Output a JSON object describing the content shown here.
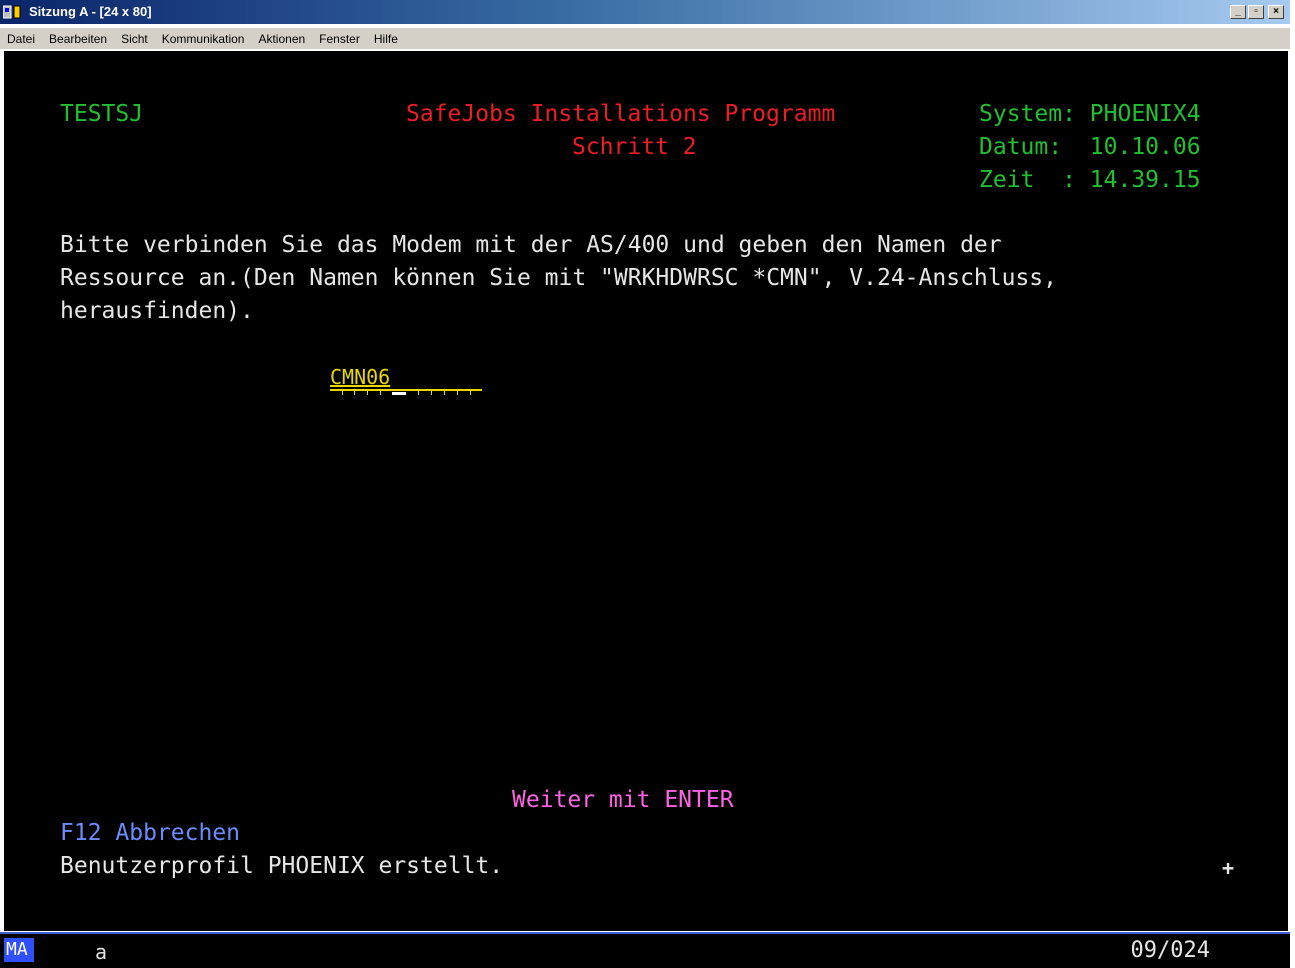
{
  "window": {
    "title": "Sitzung A - [24 x 80]",
    "buttons": {
      "minimize": "_",
      "maximize": "▫",
      "close": "×"
    }
  },
  "menu": [
    "Datei",
    "Bearbeiten",
    "Sicht",
    "Kommunikation",
    "Aktionen",
    "Fenster",
    "Hilfe"
  ],
  "screen": {
    "program_id": "TESTSJ",
    "title": "SafeJobs Installations Programm",
    "subtitle": "Schritt 2",
    "system_line": "System: PHOENIX4",
    "date_line": "Datum:  10.10.06",
    "time_line": "Zeit  : 14.39.15",
    "instruction_lines": [
      "Bitte verbinden Sie das Modem mit der AS/400 und geben den Namen der",
      "Ressource an.(Den Namen können Sie mit \"WRKHDWRSC *CMN\", V.24-Anschluss,",
      "herausfinden)."
    ],
    "input_value": "CMN06",
    "continue_text": "Weiter mit ENTER",
    "function_key": "F12 Abbrechen",
    "message": "Benutzerprofil PHOENIX erstellt.",
    "more_indicator": "+"
  },
  "status": {
    "mode": "MA",
    "indicator": "a",
    "cursor_position": "09/024"
  },
  "colors": {
    "background": "#000000",
    "field_green": "#20c030",
    "title_red": "#ee1c24",
    "input_yellow": "#e8d800",
    "hint_pink": "#ff62e4",
    "function_blue": "#6b8cff"
  }
}
